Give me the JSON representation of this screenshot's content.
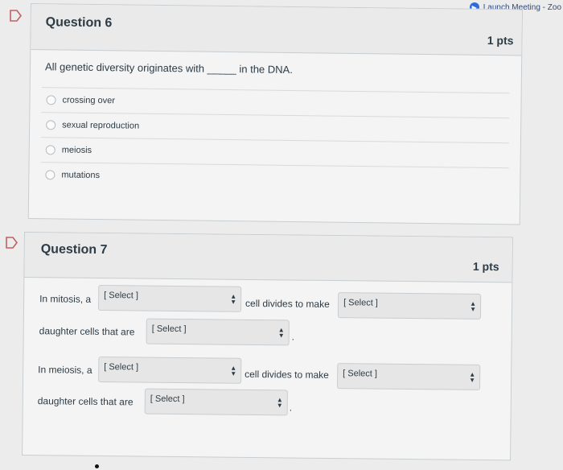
{
  "topbar": {
    "zoom_label": "Launch Meeting - Zoo"
  },
  "q6": {
    "title": "Question 6",
    "points": "1 pts",
    "prompt_before": "All genetic diversity originates with",
    "blank": "_____",
    "prompt_after": "in the DNA.",
    "answers": [
      "crossing over",
      "sexual reproduction",
      "meiosis",
      "mutations"
    ]
  },
  "q7": {
    "title": "Question 7",
    "points": "1 pts",
    "mitosis_prefix": "In mitosis, a",
    "meiosis_prefix": "In meiosis, a",
    "cell_divides": "cell divides to make",
    "daughter_cells": "daughter cells that are",
    "select_placeholder": "[ Select ]",
    "period": "."
  }
}
